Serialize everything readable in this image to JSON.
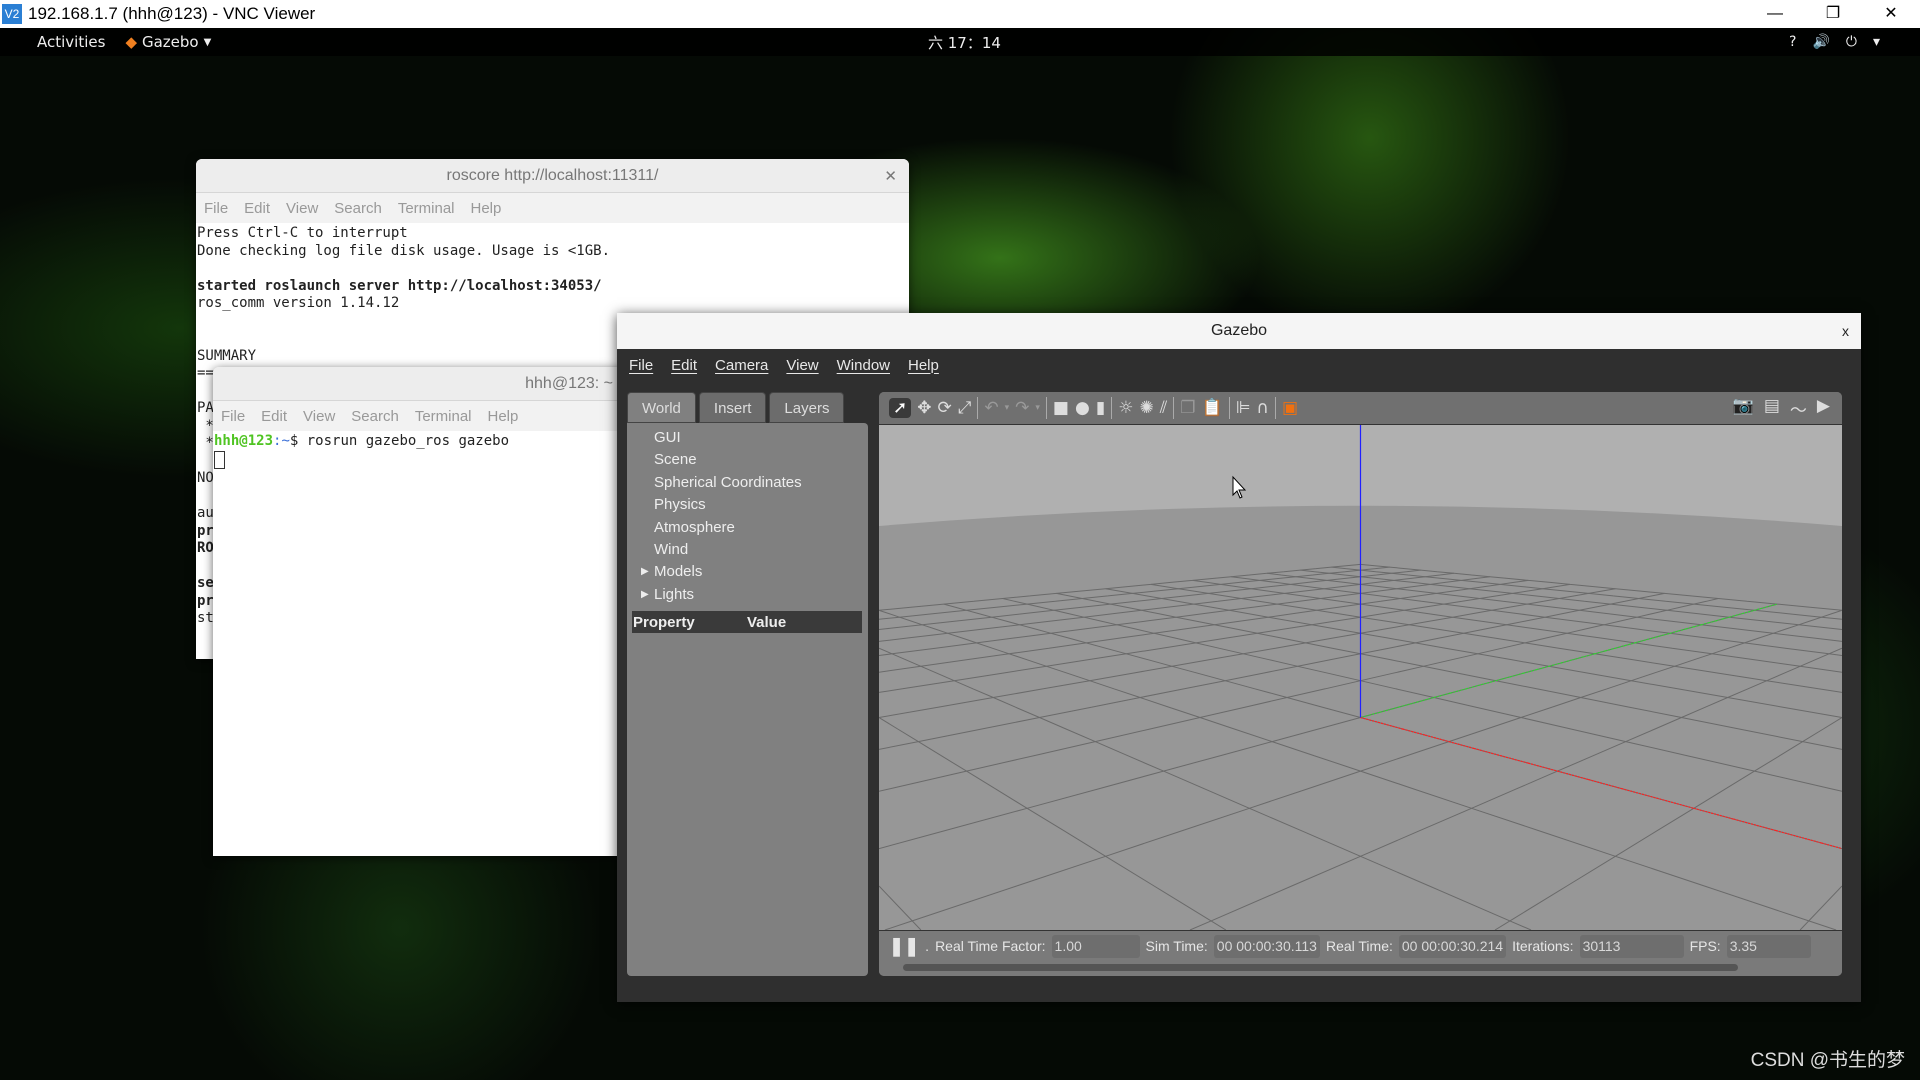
{
  "vnc": {
    "title": "192.168.1.7 (hhh@123) - VNC Viewer",
    "logo": "V2",
    "minimize": "—",
    "restore": "❐",
    "close": "✕"
  },
  "topbar": {
    "activities": "Activities",
    "app": "Gazebo",
    "clock": "六 17：14",
    "tray": [
      "network-question-icon",
      "volume-icon",
      "power-icon",
      "chevron-down-icon"
    ]
  },
  "roscore": {
    "title": "roscore http://localhost:11311/",
    "menu": [
      "File",
      "Edit",
      "View",
      "Search",
      "Terminal",
      "Help"
    ],
    "lines": [
      "Press Ctrl-C to interrupt",
      "Done checking log file disk usage. Usage is <1GB.",
      "",
      "started roslaunch server http://localhost:34053/",
      "ros_comm version 1.14.12",
      "",
      "",
      "SUMMARY",
      "==",
      "",
      "PA",
      " *",
      " *",
      "",
      "NO",
      "",
      "au",
      "pr",
      "RO",
      "",
      "se",
      "pr",
      "st"
    ]
  },
  "terminal2": {
    "title": "hhh@123: ~",
    "menu": [
      "File",
      "Edit",
      "View",
      "Search",
      "Terminal",
      "Help"
    ],
    "prompt_user": "hhh@123",
    "prompt_path": ":~",
    "prompt_sym": "$ ",
    "command": "rosrun gazebo_ros gazebo"
  },
  "gazebo": {
    "title": "Gazebo",
    "close": "x",
    "menu": [
      "File",
      "Edit",
      "Camera",
      "View",
      "Window",
      "Help"
    ],
    "tabs": [
      "World",
      "Insert",
      "Layers"
    ],
    "tree": [
      {
        "label": "GUI"
      },
      {
        "label": "Scene"
      },
      {
        "label": "Spherical Coordinates"
      },
      {
        "label": "Physics"
      },
      {
        "label": "Atmosphere"
      },
      {
        "label": "Wind"
      },
      {
        "label": "Models",
        "expandable": true
      },
      {
        "label": "Lights",
        "expandable": true
      }
    ],
    "property_header": "Property",
    "value_header": "Value",
    "status": {
      "real_time_factor_label": "Real Time Factor:",
      "real_time_factor": "1.00",
      "sim_time_label": "Sim Time:",
      "sim_time": "00 00:00:30.113",
      "real_time_label": "Real Time:",
      "real_time": "00 00:00:30.214",
      "iterations_label": "Iterations:",
      "iterations": "30113",
      "fps_label": "FPS:",
      "fps": "3.35"
    },
    "axis_colors": {
      "x": "#ff2020",
      "y": "#30d030",
      "z": "#2020ff"
    }
  },
  "watermark": "CSDN @书生的梦"
}
